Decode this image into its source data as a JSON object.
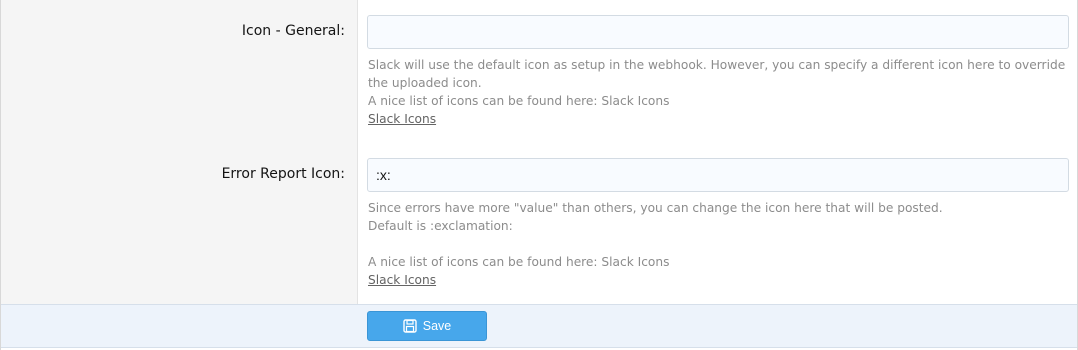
{
  "options": [
    {
      "label": "Icon - General:",
      "value": "",
      "explain_lines": [
        "Slack will use the default icon as setup in the webhook. However, you can specify a different icon here to override the uploaded icon.",
        "A nice list of icons can be found here: Slack Icons"
      ],
      "link_text": "Slack Icons"
    },
    {
      "label": "Error Report Icon:",
      "value": ":x:",
      "explain_lines": [
        "Since errors have more \"value\" than others, you can change the icon here that will be posted.",
        "Default is :exclamation:",
        "A nice list of icons can be found here: Slack Icons"
      ],
      "link_text": "Slack Icons"
    }
  ],
  "submit": {
    "save_label": "Save",
    "icon": "save-icon"
  }
}
